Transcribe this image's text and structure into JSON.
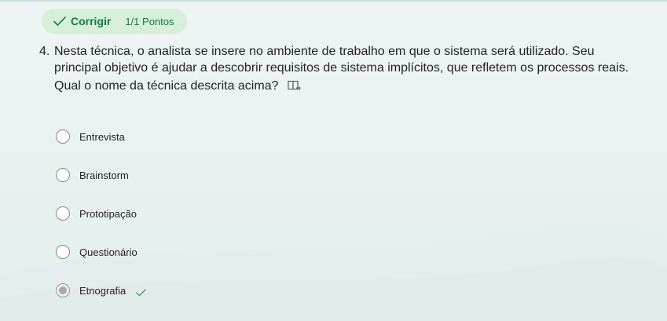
{
  "status": {
    "label": "Corrigir",
    "points": "1/1 Pontos"
  },
  "question": {
    "number": "4.",
    "text": "Nesta técnica, o analista se insere no ambiente de trabalho em que o sistema será utilizado. Seu principal objetivo é ajudar a descobrir requisitos de sistema implícitos, que refletem os processos reais.",
    "prompt": "Qual o nome da técnica descrita acima?"
  },
  "options": [
    {
      "label": "Entrevista"
    },
    {
      "label": "Brainstorm"
    },
    {
      "label": "Prototipação"
    },
    {
      "label": "Questionário"
    },
    {
      "label": "Etnografia"
    }
  ],
  "selected_option": "Etnografia",
  "icons": {
    "status": "check-icon",
    "reader": "immersive-reader-icon",
    "correct": "correct-check-icon"
  },
  "colors": {
    "accent_green": "#107c41",
    "pill_background": "#d7efd9"
  }
}
